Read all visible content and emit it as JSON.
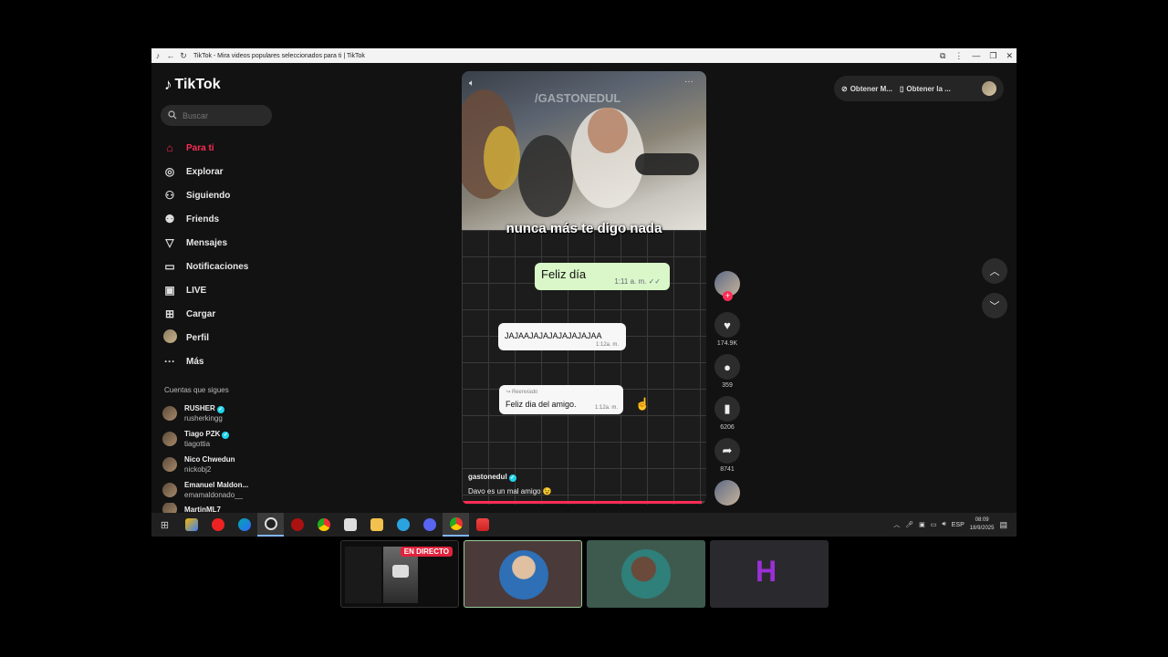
{
  "browser": {
    "tab_title": "TikTok - Mira videos populares seleccionados para ti | TikTok"
  },
  "sidebar": {
    "logo": "TikTok",
    "search_placeholder": "Buscar",
    "nav": [
      {
        "label": "Para ti",
        "icon": "home-icon",
        "active": true
      },
      {
        "label": "Explorar",
        "icon": "compass-icon"
      },
      {
        "label": "Siguiendo",
        "icon": "following-icon"
      },
      {
        "label": "Friends",
        "icon": "friends-icon"
      },
      {
        "label": "Mensajes",
        "icon": "send-icon"
      },
      {
        "label": "Notificaciones",
        "icon": "inbox-icon"
      },
      {
        "label": "LIVE",
        "icon": "live-icon"
      },
      {
        "label": "Cargar",
        "icon": "upload-icon"
      },
      {
        "label": "Perfil",
        "icon": "avatar"
      },
      {
        "label": "Más",
        "icon": "more-icon"
      }
    ],
    "following_title": "Cuentas que sigues",
    "following": [
      {
        "name": "RUSHER",
        "handle": "rusherkingg",
        "verified": true
      },
      {
        "name": "Tiago PZK",
        "handle": "tiagottia",
        "verified": true
      },
      {
        "name": "Nico Chwedun",
        "handle": "nickobj2",
        "verified": false
      },
      {
        "name": "Emanuel Maldon...",
        "handle": "emamaldonado__",
        "verified": false
      },
      {
        "name": "MartinML7",
        "handle": "",
        "verified": false
      }
    ]
  },
  "top_actions": {
    "get_app_1": "Obtener M...",
    "get_app_2": "Obtener la ..."
  },
  "video": {
    "watermark": "/GASTONEDUL",
    "caption_overlay": "nunca más te digo nada",
    "chat": {
      "msg1": "Feliz día",
      "msg1_time": "1:11 a. m.",
      "msg2": "JAJAAJAJAJAJAJAJAJAA",
      "msg2_time": "1:12a. m.",
      "forwarded_label": "Reenviado",
      "msg3": "Feliz dia del amigo.",
      "msg3_time": "1:12a. m."
    },
    "author": "gastonedul",
    "description": "Davo es un mal amigo 😉",
    "progress": 0.98
  },
  "actions": {
    "likes": "174.9K",
    "comments": "359",
    "saves": "6206",
    "shares": "8741"
  },
  "taskbar": {
    "language": "ESP",
    "time": "08:09",
    "date": "18/9/2025"
  },
  "thumbnails": {
    "live_badge": "EN DIRECTO"
  },
  "colors": {
    "accent": "#fe2c55",
    "verified": "#20d5ec",
    "bubble_out": "#d9f7c8"
  }
}
